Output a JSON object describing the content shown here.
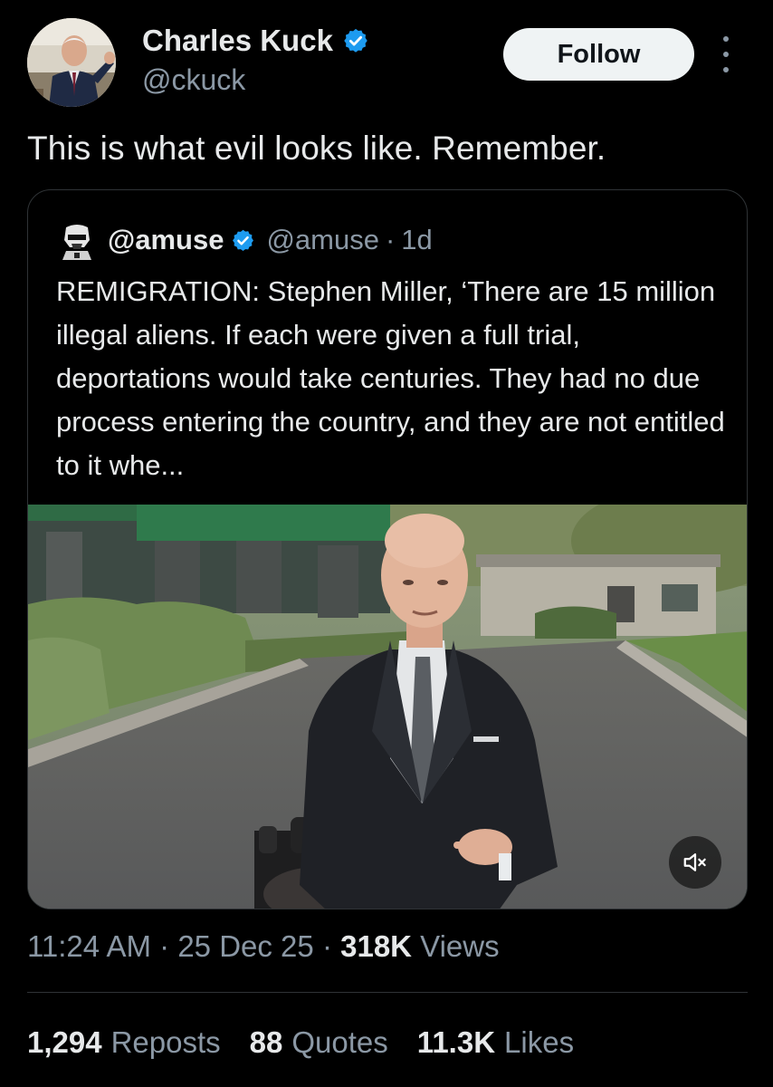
{
  "author": {
    "name": "Charles Kuck",
    "handle": "@ckuck",
    "verified": true,
    "avatar_icon": "profile-photo"
  },
  "actions": {
    "follow_label": "Follow",
    "more_icon": "more-vertical-icon"
  },
  "tweet": {
    "text": "This is what evil looks like. Remember."
  },
  "quoted": {
    "name": "@amuse",
    "handle": "@amuse",
    "separator": "·",
    "time": "1d",
    "verified": true,
    "body": "REMIGRATION: Stephen Miller, ‘There are 15 million illegal aliens. If each were given a full trial, deportations would take centuries. They had no due process entering the country, and they are not entitled to it whe...",
    "media_icon": "video-thumbnail",
    "mute_icon": "speaker-muted-icon"
  },
  "meta": {
    "time": "11:24 AM",
    "sep1": "·",
    "date": "25 Dec 25",
    "sep2": "·",
    "views_count": "318K",
    "views_label": "Views"
  },
  "stats": {
    "reposts_count": "1,294",
    "reposts_label": "Reposts",
    "quotes_count": "88",
    "quotes_label": "Quotes",
    "likes_count": "11.3K",
    "likes_label": "Likes"
  },
  "colors": {
    "background": "#000000",
    "text": "#e7e9ea",
    "muted": "#8b98a5",
    "verified": "#1d9bf0",
    "border": "#2f3336"
  }
}
